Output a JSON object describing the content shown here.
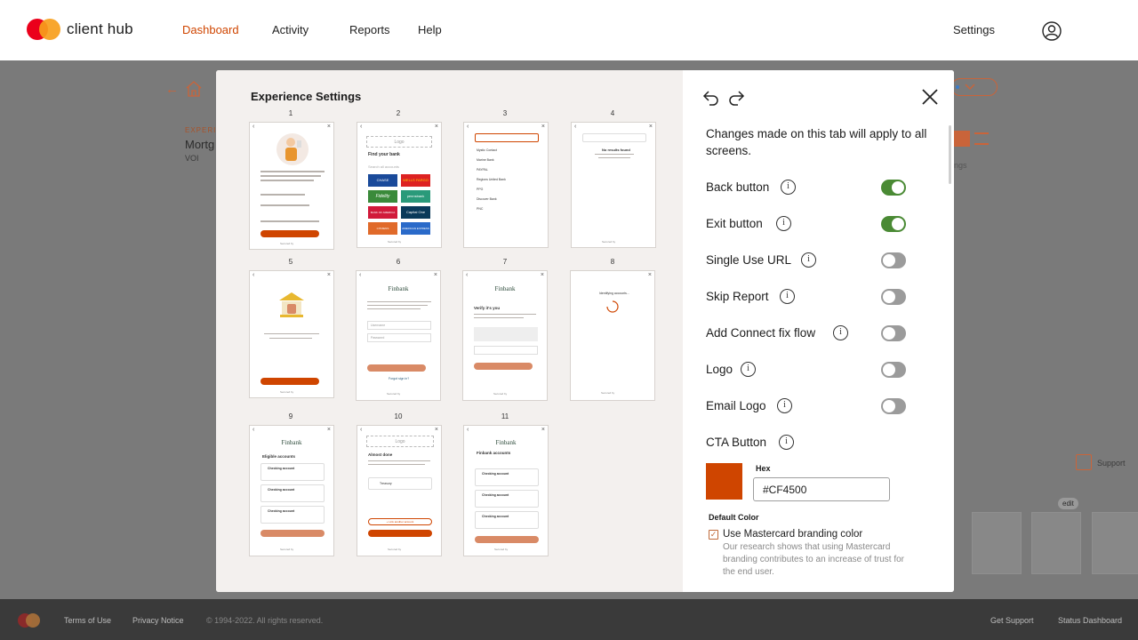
{
  "header": {
    "brand_name": "client hub",
    "nav": [
      {
        "label": "Dashboard",
        "active": true
      },
      {
        "label": "Activity",
        "active": false
      },
      {
        "label": "Reports",
        "active": false
      },
      {
        "label": "Help",
        "active": false
      }
    ],
    "settings_label": "Settings",
    "user_icon": "user-circle-icon"
  },
  "background": {
    "back_arrow": "←",
    "section_label": "EXPERIE",
    "title": "Mortg",
    "subtitle": "VOI",
    "ngs_text": "ngs",
    "support_label": "Support",
    "edit_label": "edit"
  },
  "footer": {
    "terms": "Terms of Use",
    "privacy": "Privacy Notice",
    "copyright": "© 1994-2022. All rights reserved.",
    "get_support": "Get Support",
    "status": "Status Dashboard"
  },
  "modal": {
    "title": "Experience Settings",
    "screens": [
      {
        "num": "1"
      },
      {
        "num": "2"
      },
      {
        "num": "3"
      },
      {
        "num": "4"
      },
      {
        "num": "5"
      },
      {
        "num": "6"
      },
      {
        "num": "7"
      },
      {
        "num": "8"
      },
      {
        "num": "9"
      },
      {
        "num": "10"
      },
      {
        "num": "11"
      }
    ],
    "thumb_text": {
      "logo": "Logo",
      "find_bank": "Find your bank",
      "search": "Search all accounts",
      "start": "Start",
      "submit": "Submit",
      "finbank": "Finbank",
      "verify": "Verify it's you",
      "eligible": "Eligible accounts",
      "almost_done": "Almost done",
      "finbank_accounts": "Finbank accounts",
      "checking": "Checking account",
      "done": "Done",
      "no_results": "No results found",
      "identifying": "Identifying accounts...",
      "secured": "Secured by",
      "username": "Username",
      "password": "Password",
      "forgot": "Forgot sign in?",
      "add_another": "+ Link another account",
      "treasury": "Treasury",
      "banks": [
        "CHASE",
        "WELLS FARGO",
        "Fidelity",
        "pennsbank",
        "BANK OF AMERICA",
        "Capital One",
        "CITIZENS",
        "AMERICAN EXPRESS"
      ],
      "results": [
        "Mystic Contact",
        "Marine Bank",
        "PAYPAL",
        "Regions United Bank",
        "PPG",
        "Discover Bank",
        "PNC"
      ]
    },
    "settings": {
      "intro": "Changes made on this tab will apply to all screens.",
      "toggles": [
        {
          "label": "Back button",
          "on": true
        },
        {
          "label": "Exit button",
          "on": true
        },
        {
          "label": "Single Use URL",
          "on": false
        },
        {
          "label": "Skip Report",
          "on": false
        },
        {
          "label": "Add Connect fix flow",
          "on": false
        },
        {
          "label": "Logo",
          "on": false
        },
        {
          "label": "Email Logo",
          "on": false
        }
      ],
      "cta_label": "CTA Button",
      "hex_label": "Hex",
      "hex_value": "#CF4500",
      "default_color_label": "Default Color",
      "checkbox_label": "Use Mastercard branding color",
      "checkbox_checked": true,
      "checkbox_desc": "Our research shows that using Mastercard branding contributes to an increase of trust for the end user."
    }
  },
  "colors": {
    "accent": "#cf4500",
    "toggle_on": "#4a8a34",
    "toggle_off": "#9b9b9b"
  }
}
